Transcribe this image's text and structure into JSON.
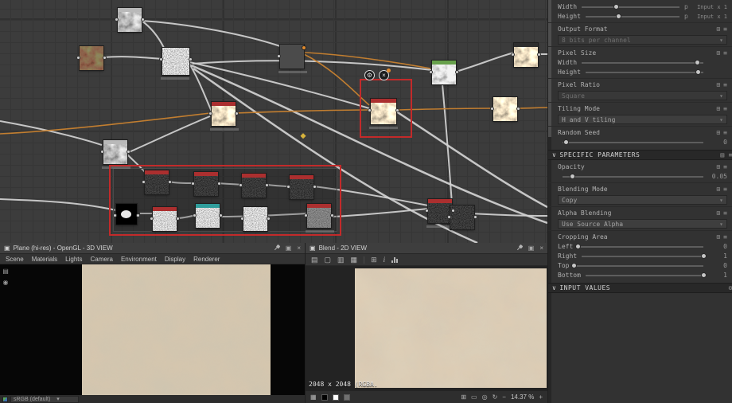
{
  "icons": {
    "expose": "⊞",
    "menu": "≡",
    "caret": "▾",
    "chevron": "∨",
    "gear": "⚙",
    "maximize": "▣",
    "close": "×",
    "window": "▣",
    "display": "▤",
    "camera": "◉",
    "save": "▤",
    "copy": "▢",
    "export": "▥",
    "channels": "▦",
    "info": "i",
    "checker": "▦",
    "fit": "⊞",
    "actual_size": "▭",
    "center": "◎",
    "rotate": "↻",
    "minus": "−",
    "plus": "+"
  },
  "panel": {
    "width_row": {
      "label": "Width",
      "unit": "p",
      "link": "Input x 1"
    },
    "height_row": {
      "label": "Height",
      "unit": "p",
      "link": "Input x 1"
    },
    "output_format": {
      "label": "Output Format",
      "value": "8 bits per channel"
    },
    "pixel_size": {
      "label": "Pixel Size",
      "width_label": "Width",
      "height_label": "Height",
      "width_value": "",
      "height_value": ""
    },
    "pixel_ratio": {
      "label": "Pixel Ratio",
      "value": "Square"
    },
    "tiling_mode": {
      "label": "Tiling Mode",
      "value": "H and V tiling"
    },
    "random_seed": {
      "label": "Random Seed",
      "value": "0"
    },
    "specific_parameters": {
      "label": "SPECIFIC PARAMETERS"
    },
    "opacity": {
      "label": "Opacity",
      "value": "0.05"
    },
    "blending_mode": {
      "label": "Blending Mode",
      "value": "Copy"
    },
    "alpha_blending": {
      "label": "Alpha Blending",
      "value": "Use Source Alpha"
    },
    "cropping_area": {
      "label": "Cropping Area",
      "left": {
        "label": "Left",
        "value": "0"
      },
      "right": {
        "label": "Right",
        "value": "1"
      },
      "top": {
        "label": "Top",
        "value": "0"
      },
      "bottom": {
        "label": "Bottom",
        "value": "1"
      }
    },
    "input_values": {
      "label": "INPUT VALUES"
    }
  },
  "view3d": {
    "title": "Plane (hi-res) - OpenGL - 3D VIEW",
    "menus": [
      "Scene",
      "Materials",
      "Lights",
      "Camera",
      "Environment",
      "Display",
      "Renderer"
    ],
    "colorspace": "sRGB (default)"
  },
  "view2d": {
    "title": "Blend - 2D VIEW",
    "size_label": "2048 x 2048 (RGBA.",
    "zoom": "14.37 %"
  }
}
